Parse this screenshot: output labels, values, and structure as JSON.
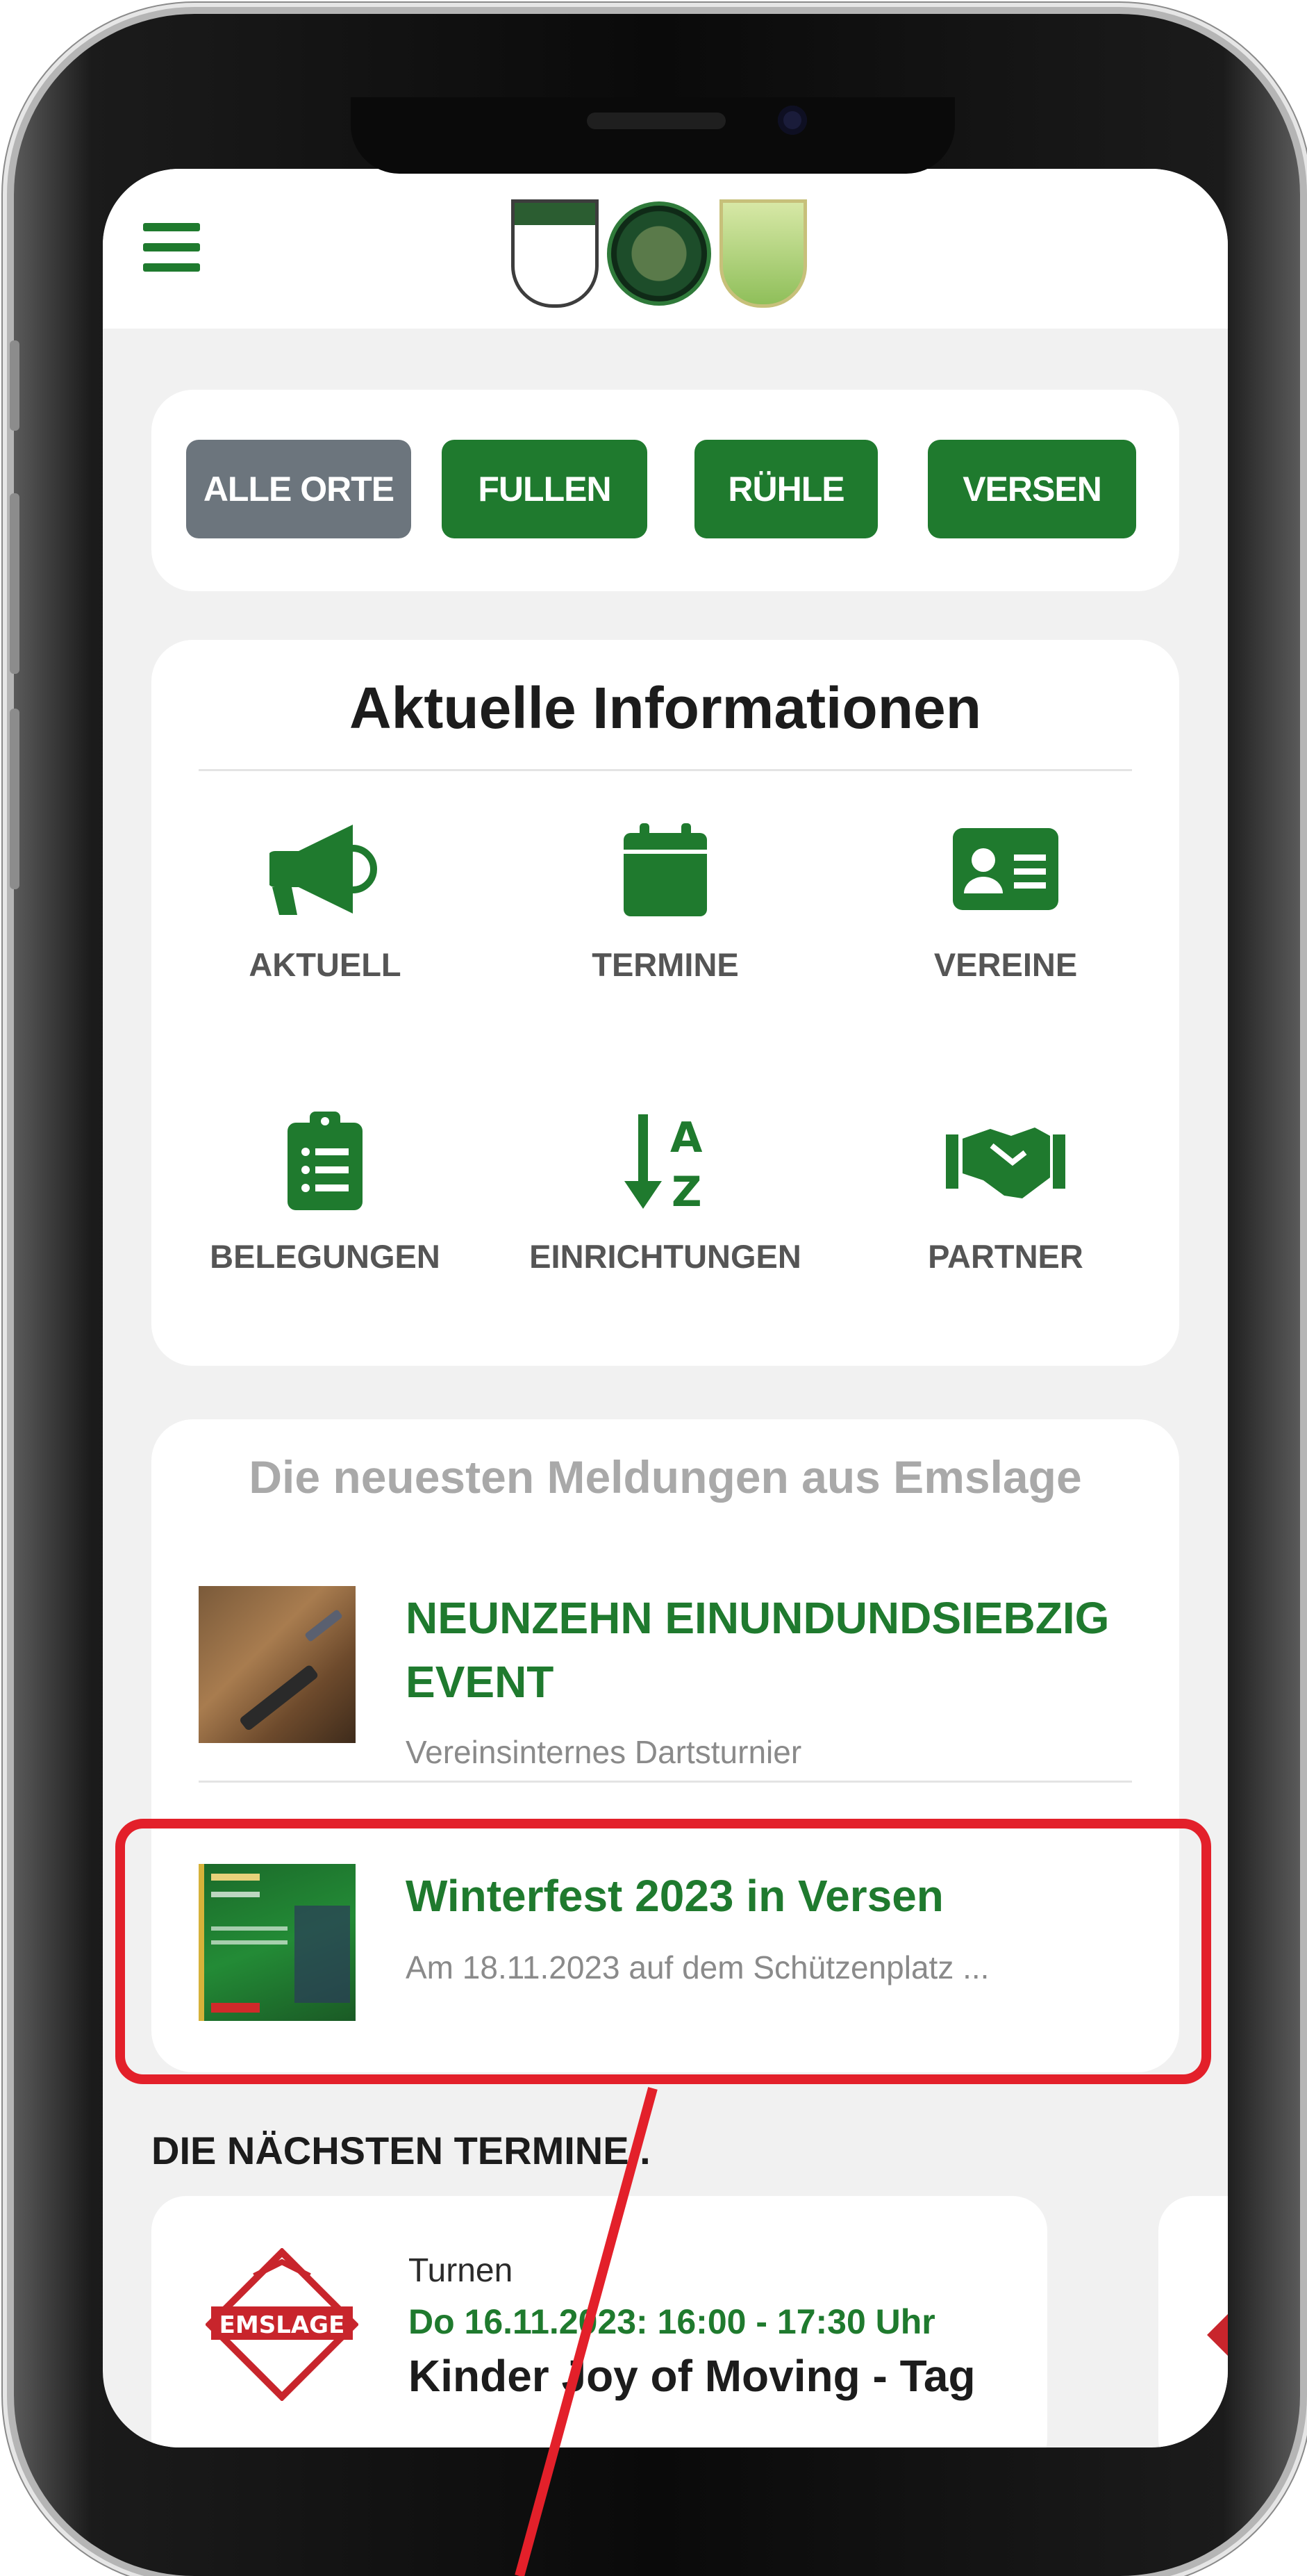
{
  "header": {
    "menu_icon": "hamburger-menu-icon",
    "logos": [
      "crest-left-logo",
      "round-seal-logo",
      "crest-right-logo"
    ]
  },
  "places": {
    "buttons": [
      {
        "label": "ALLE ORTE",
        "active": true
      },
      {
        "label": "FULLEN",
        "active": false
      },
      {
        "label": "RÜHLE",
        "active": false
      },
      {
        "label": "VERSEN",
        "active": false
      }
    ]
  },
  "info": {
    "title": "Aktuelle Informationen",
    "tiles": [
      {
        "label": "AKTUELL",
        "icon": "megaphone-icon"
      },
      {
        "label": "TERMINE",
        "icon": "calendar-icon"
      },
      {
        "label": "VEREINE",
        "icon": "id-card-icon"
      },
      {
        "label": "BELEGUNGEN",
        "icon": "clipboard-list-icon"
      },
      {
        "label": "EINRICHTUNGEN",
        "icon": "sort-alpha-icon"
      },
      {
        "label": "PARTNER",
        "icon": "handshake-icon"
      }
    ]
  },
  "news": {
    "heading": "Die neuesten Meldungen aus Emslage",
    "items": [
      {
        "title": "NEUNZEHN EINUNDUNDSIEBZIG EVENT",
        "subtitle": "Vereinsinternes Dartsturnier"
      },
      {
        "title": "Winterfest 2023 in Versen",
        "subtitle": "Am 18.11.2023 auf dem Schützenplatz ..."
      }
    ]
  },
  "termine": {
    "heading": "DIE NÄCHSTEN TERMINE..",
    "events": [
      {
        "category": "Turnen",
        "date": "Do 16.11.2023: 16:00 - 17:30 Uhr",
        "title": "Kinder Joy of Moving - Tag",
        "logo_text": "EMSLAGE"
      }
    ]
  },
  "colors": {
    "brand_green": "#1f7a2e",
    "inactive_gray": "#6c757d",
    "annotation_red": "#e3202a"
  }
}
